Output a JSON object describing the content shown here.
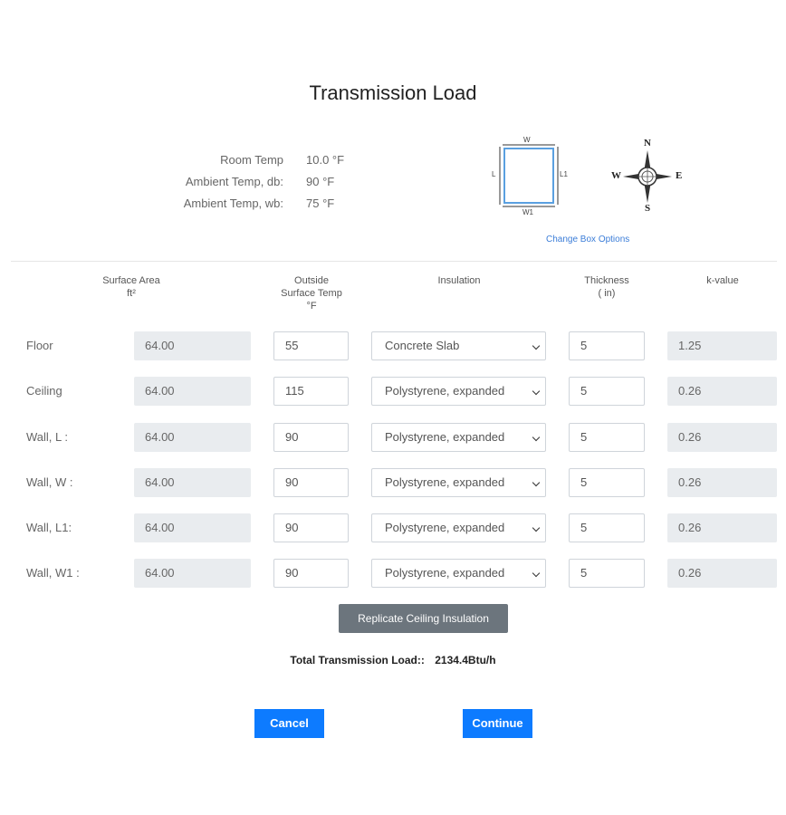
{
  "page": {
    "title": "Transmission Load"
  },
  "conditions": [
    {
      "label": "Room Temp",
      "value": "10.0 °F"
    },
    {
      "label": "Ambient Temp, db:",
      "value": "90 °F"
    },
    {
      "label": "Ambient Temp, wb:",
      "value": "75 °F"
    }
  ],
  "box_diagram": {
    "top": "W",
    "bottom": "W1",
    "left": "L",
    "right": "L1"
  },
  "compass": {
    "n": "N",
    "s": "S",
    "e": "E",
    "w": "W"
  },
  "change_box_link": "Change Box Options",
  "columns": {
    "surface_area": [
      "Surface Area",
      "ft²"
    ],
    "outside_temp": [
      "Outside",
      "Surface Temp",
      "°F"
    ],
    "insulation": [
      "Insulation"
    ],
    "thickness": [
      "Thickness",
      "( in)"
    ],
    "k_value": [
      "k-value"
    ]
  },
  "rows": [
    {
      "label": "Floor",
      "area": "64.00",
      "temp": "55",
      "insulation": "Concrete Slab",
      "thickness": "5",
      "k": "1.25"
    },
    {
      "label": "Ceiling",
      "area": "64.00",
      "temp": "115",
      "insulation": "Polystyrene, expanded",
      "thickness": "5",
      "k": "0.26"
    },
    {
      "label": "Wall, L :",
      "area": "64.00",
      "temp": "90",
      "insulation": "Polystyrene, expanded",
      "thickness": "5",
      "k": "0.26"
    },
    {
      "label": "Wall, W :",
      "area": "64.00",
      "temp": "90",
      "insulation": "Polystyrene, expanded",
      "thickness": "5",
      "k": "0.26"
    },
    {
      "label": "Wall, L1:",
      "area": "64.00",
      "temp": "90",
      "insulation": "Polystyrene, expanded",
      "thickness": "5",
      "k": "0.26"
    },
    {
      "label": "Wall, W1 :",
      "area": "64.00",
      "temp": "90",
      "insulation": "Polystyrene, expanded",
      "thickness": "5",
      "k": "0.26"
    }
  ],
  "replicate_button": "Replicate Ceiling Insulation",
  "total": {
    "label": "Total Transmission Load::",
    "value": "2134.4Btu/h"
  },
  "buttons": {
    "cancel": "Cancel",
    "continue": "Continue"
  },
  "colors": {
    "primary": "#0d7bff",
    "secondary": "#6c757d",
    "readonly_bg": "#e9ecef",
    "link": "#3b7dd8"
  }
}
